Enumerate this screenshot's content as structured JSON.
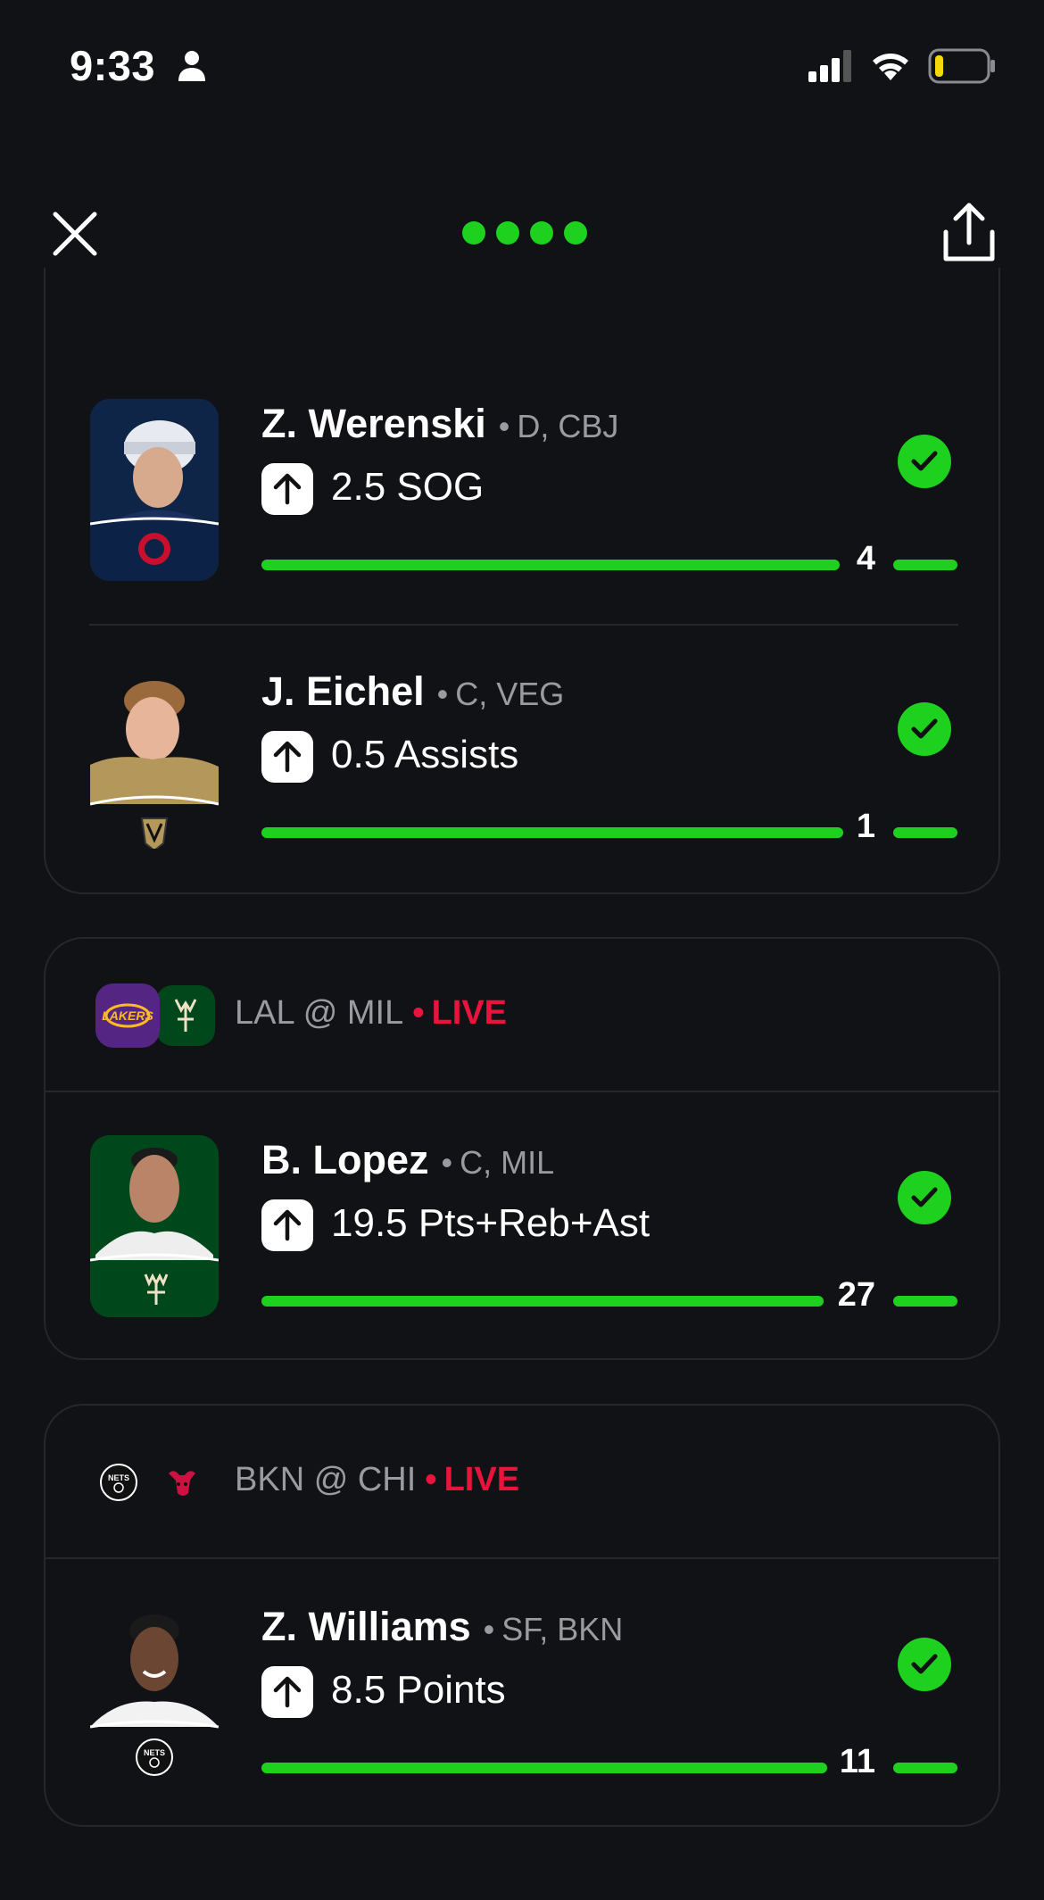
{
  "status_bar": {
    "time": "9:33",
    "icons": [
      "person-icon",
      "cellular-signal-icon",
      "wifi-icon",
      "battery-low-icon"
    ]
  },
  "nav": {
    "close_icon": "close-icon",
    "share_icon": "share-icon",
    "page_count": 4
  },
  "colors": {
    "accent_green": "#1ed11e",
    "live_red": "#e8143c",
    "background": "#111215",
    "muted_text": "#9a9ba1"
  },
  "games": [
    {
      "matchup": "",
      "live": "",
      "picks": [
        {
          "name": "Z. Werenski",
          "position": "D, CBJ",
          "direction": "over",
          "line": "2.5 SOG",
          "value": "4",
          "progress": 1.0,
          "status": "hit"
        },
        {
          "name": "J. Eichel",
          "position": "C, VEG",
          "direction": "over",
          "line": "0.5 Assists",
          "value": "1",
          "progress": 1.0,
          "status": "hit"
        }
      ]
    },
    {
      "matchup": "LAL @ MIL",
      "live": "LIVE",
      "team_logos": [
        "lakers-logo",
        "bucks-logo"
      ],
      "picks": [
        {
          "name": "B. Lopez",
          "position": "C, MIL",
          "direction": "over",
          "line": "19.5 Pts+Reb+Ast",
          "value": "27",
          "progress": 1.0,
          "status": "hit"
        }
      ]
    },
    {
      "matchup": "BKN @ CHI",
      "live": "LIVE",
      "team_logos": [
        "nets-logo",
        "bulls-logo"
      ],
      "picks": [
        {
          "name": "Z. Williams",
          "position": "SF, BKN",
          "direction": "over",
          "line": "8.5 Points",
          "value": "11",
          "progress": 1.0,
          "status": "hit"
        }
      ]
    }
  ]
}
